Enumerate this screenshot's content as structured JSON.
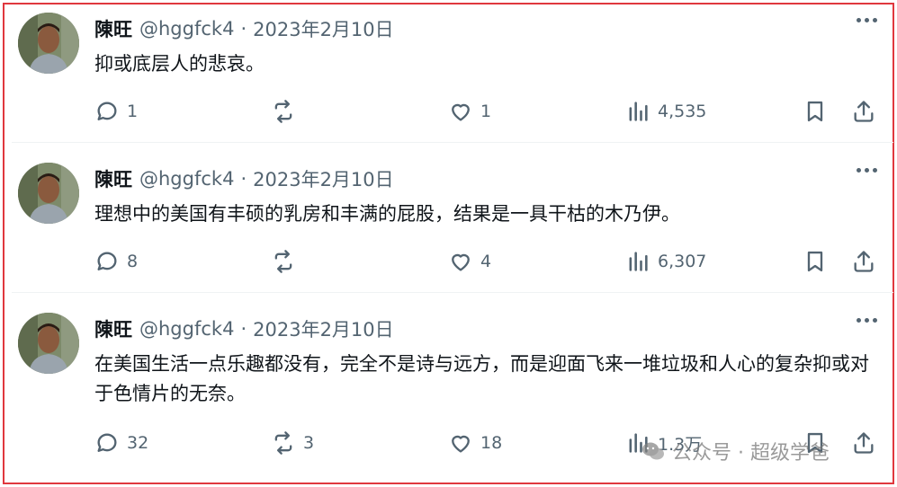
{
  "tweets": [
    {
      "name": "陳旺",
      "handle": "@hggfck4",
      "separator": "·",
      "date": "2023年2月10日",
      "text": "抑或底层人的悲哀。",
      "replies": "1",
      "retweets": "",
      "likes": "1",
      "views": "4,535"
    },
    {
      "name": "陳旺",
      "handle": "@hggfck4",
      "separator": "·",
      "date": "2023年2月10日",
      "text": "理想中的美国有丰硕的乳房和丰满的屁股，结果是一具干枯的木乃伊。",
      "replies": "8",
      "retweets": "",
      "likes": "4",
      "views": "6,307"
    },
    {
      "name": "陳旺",
      "handle": "@hggfck4",
      "separator": "·",
      "date": "2023年2月10日",
      "text": "在美国生活一点乐趣都没有，完全不是诗与远方，而是迎面飞来一堆垃圾和人心的复杂抑或对于色情片的无奈。",
      "replies": "32",
      "retweets": "3",
      "likes": "18",
      "views": "1.3万"
    }
  ],
  "watermark": {
    "text": "公众号 · 超级学爸"
  },
  "colors": {
    "frame_border": "#e0383e",
    "text_primary": "#0f1419",
    "text_secondary": "#536471",
    "divider": "#eff3f4"
  },
  "icons": [
    "reply-icon",
    "retweet-icon",
    "like-icon",
    "views-icon",
    "bookmark-icon",
    "share-icon",
    "more-icon"
  ]
}
